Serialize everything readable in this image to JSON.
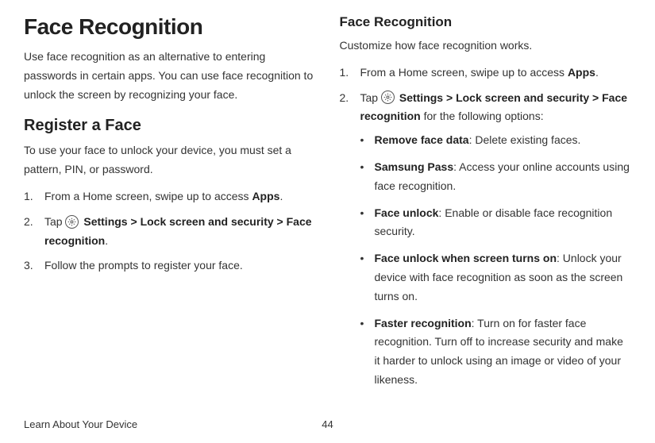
{
  "left": {
    "title": "Face Recognition",
    "intro": "Use face recognition as an alternative to entering passwords in certain apps. You can use face recognition to unlock the screen by recognizing your face.",
    "register_heading": "Register a Face",
    "register_intro": "To use your face to unlock your device, you must set a pattern, PIN, or password.",
    "step1_a": "From a Home screen, swipe up to access ",
    "step1_b": "Apps",
    "step1_c": ".",
    "step2_a": "Tap ",
    "step2_settings": "Settings",
    "step2_gt1": " > ",
    "step2_lock": "Lock screen and security",
    "step2_gt2": " > ",
    "step2_face": "Face recognition",
    "step2_end": ".",
    "step3": "Follow the prompts to register your face."
  },
  "right": {
    "heading": "Face Recognition",
    "intro": "Customize how face recognition works.",
    "step1_a": "From a Home screen, swipe up to access ",
    "step1_b": "Apps",
    "step1_c": ".",
    "step2_a": "Tap ",
    "step2_settings": "Settings",
    "step2_gt1": " > ",
    "step2_lock": "Lock screen and security",
    "step2_gt2": " > ",
    "step2_face": "Face recognition",
    "step2_end": " for the following options:",
    "opt1_b": "Remove face data",
    "opt1_t": ": Delete existing faces.",
    "opt2_b": "Samsung Pass",
    "opt2_t": ": Access your online accounts using face recognition.",
    "opt3_b": "Face unlock",
    "opt3_t": ": Enable or disable face recognition security.",
    "opt4_b": "Face unlock when screen turns on",
    "opt4_t": ": Unlock your device with face recognition as soon as the screen turns on.",
    "opt5_b": "Faster recognition",
    "opt5_t": ": Turn on for faster face recognition. Turn off to increase security and make it harder to unlock using an image or video of your likeness."
  },
  "footer": {
    "section": "Learn About Your Device",
    "page": "44"
  }
}
